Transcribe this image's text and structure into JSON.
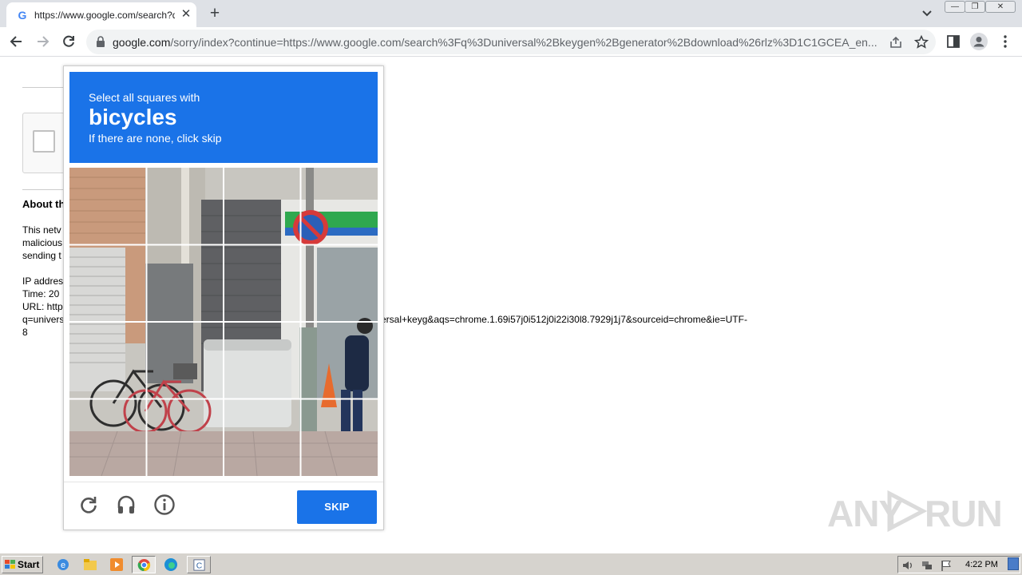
{
  "browser": {
    "tab_title": "https://www.google.com/search?q=",
    "favicon": "G",
    "new_tab_label": "+",
    "close_tab_label": "✕",
    "url_host": "google.com",
    "url_path": "/sorry/index?continue=https://www.google.com/search%3Fq%3Duniversal%2Bkeygen%2Bgenerator%2Bdownload%26rlz%3D1C1GCEA_en..."
  },
  "page": {
    "about_title": "About th",
    "about_line1": "This netv",
    "about_line2": "malicious",
    "about_line3": "sending t",
    "ip_label": "IP addres",
    "time_label": "Time: 20",
    "url_label": "URL: http",
    "url_line4_start": "q=univers",
    "url_line4_end": "ersal+keyg&aqs=chrome.1.69i57j0i512j0i22i30l8.7929j1j7&sourceid=chrome&ie=UTF-",
    "url_line5": "8"
  },
  "challenge": {
    "line1": "Select all squares with",
    "target": "bicycles",
    "line3": "If there are none, click skip",
    "skip_label": "SKIP",
    "grid_rows": 4,
    "grid_cols": 4,
    "icons": [
      "reload-icon",
      "headphones-icon",
      "info-icon"
    ],
    "header_color": "#1a73e8"
  },
  "watermark": {
    "text_left": "ANY",
    "text_right": "RUN"
  },
  "taskbar": {
    "start_label": "Start",
    "clock": "4:22 PM"
  }
}
